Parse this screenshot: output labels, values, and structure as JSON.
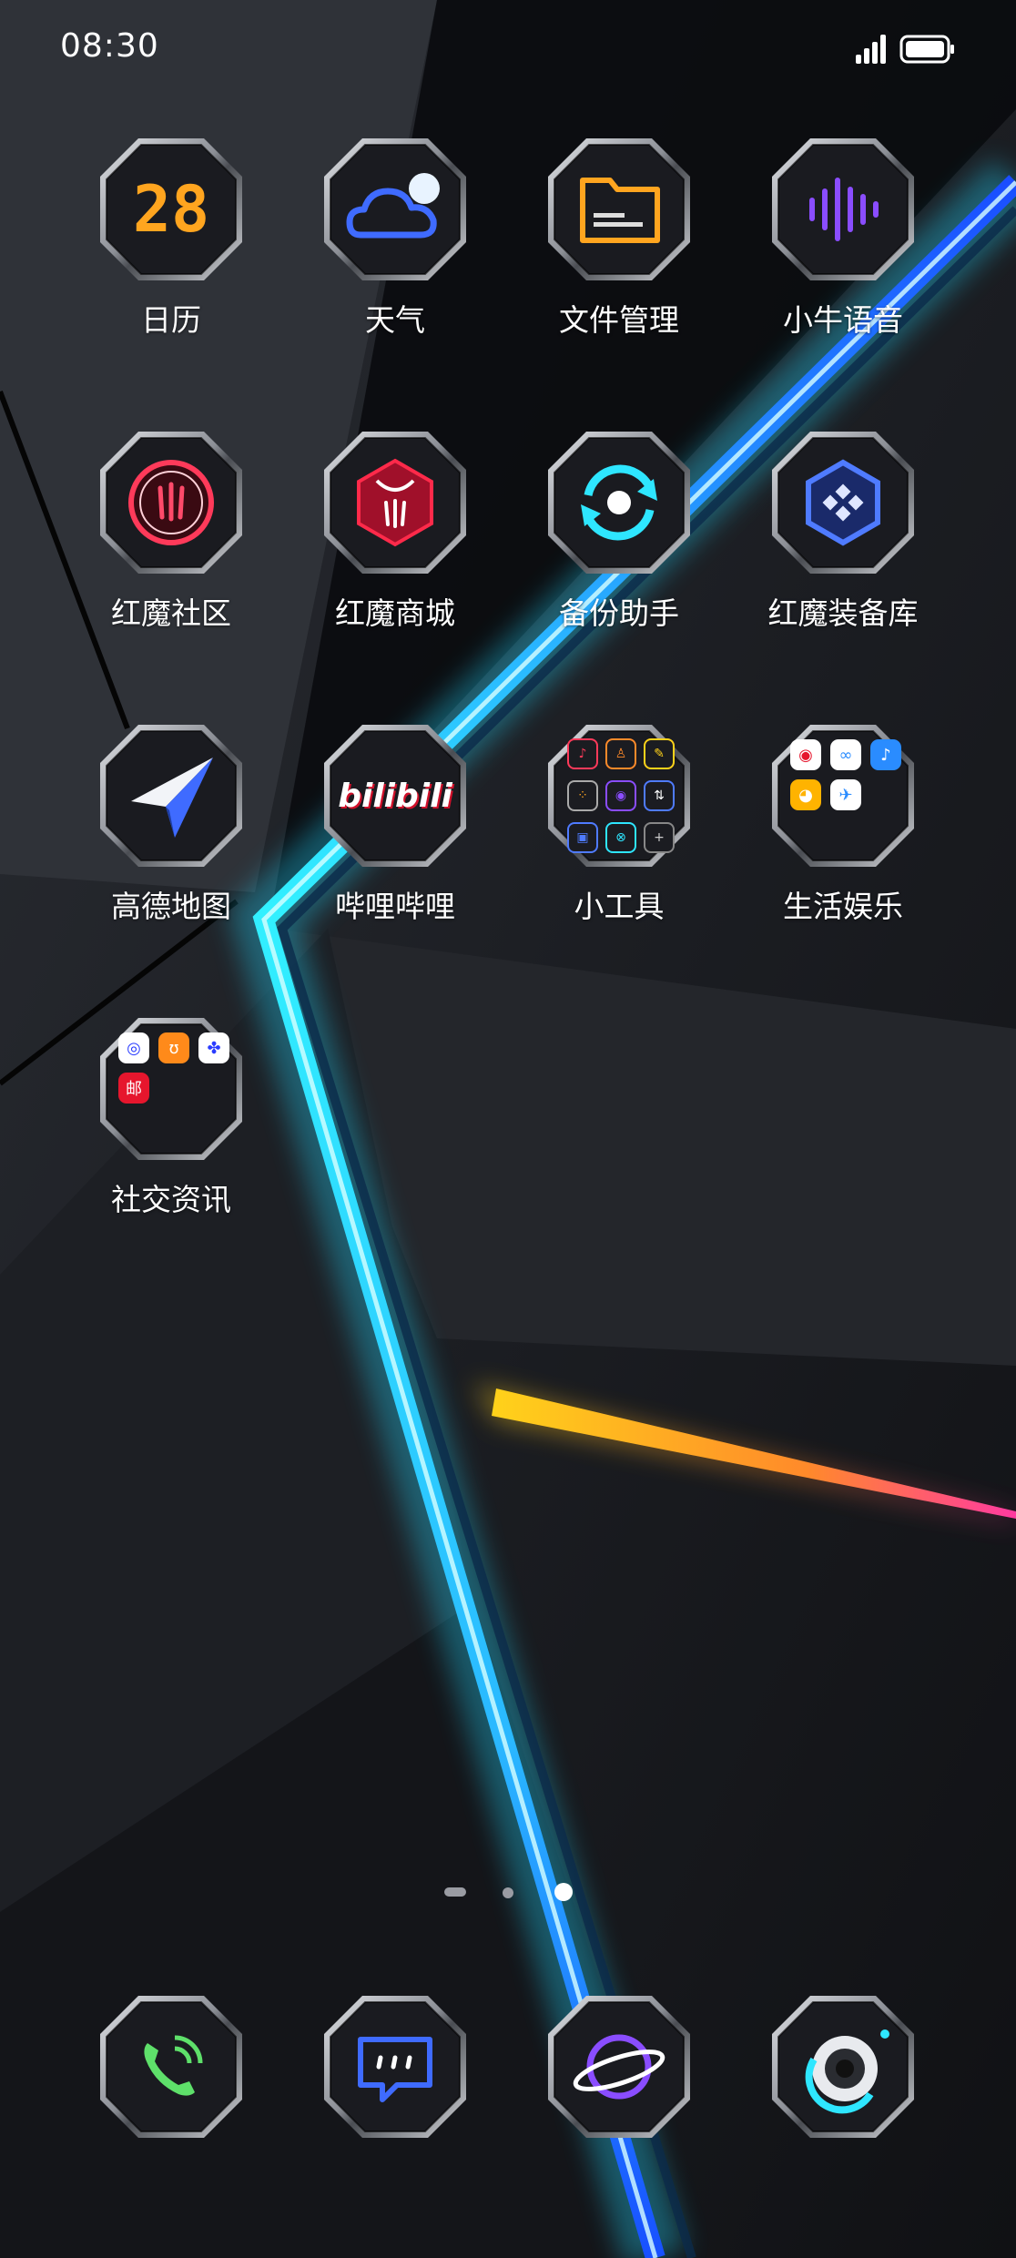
{
  "status_bar": {
    "time": "08:30",
    "signal_icon": "signal-icon",
    "battery_icon": "battery-icon"
  },
  "apps": [
    {
      "label": "日历",
      "icon": "calendar-icon",
      "date": "28"
    },
    {
      "label": "天气",
      "icon": "weather-cloud-icon"
    },
    {
      "label": "文件管理",
      "icon": "folder-icon"
    },
    {
      "label": "小牛语音",
      "icon": "voice-wave-icon"
    },
    {
      "label": "红魔社区",
      "icon": "redmagic-community-icon"
    },
    {
      "label": "红魔商城",
      "icon": "redmagic-store-icon"
    },
    {
      "label": "备份助手",
      "icon": "backup-icon"
    },
    {
      "label": "红魔装备库",
      "icon": "gamepad-hex-icon"
    },
    {
      "label": "高德地图",
      "icon": "paper-plane-map-icon"
    },
    {
      "label": "哔哩哔哩",
      "icon": "bilibili-icon",
      "logo_text": "bilibili"
    },
    {
      "label": "小工具",
      "icon": "tools-folder-icon"
    },
    {
      "label": "生活娱乐",
      "icon": "life-folder-icon"
    },
    {
      "label": "社交资讯",
      "icon": "social-folder-icon"
    }
  ],
  "folder_badges": {
    "social_mail": "邮"
  },
  "dock": [
    {
      "icon": "phone-icon"
    },
    {
      "icon": "messages-icon"
    },
    {
      "icon": "browser-planet-icon"
    },
    {
      "icon": "camera-icon"
    }
  ],
  "page_indicator": {
    "count": 3,
    "current": 3
  },
  "colors": {
    "accent_cyan": "#2ee6ff",
    "accent_orange": "#ffa51f",
    "accent_red": "#ff2a4a",
    "accent_purple": "#8a4dff",
    "accent_blue": "#3f6bff"
  }
}
